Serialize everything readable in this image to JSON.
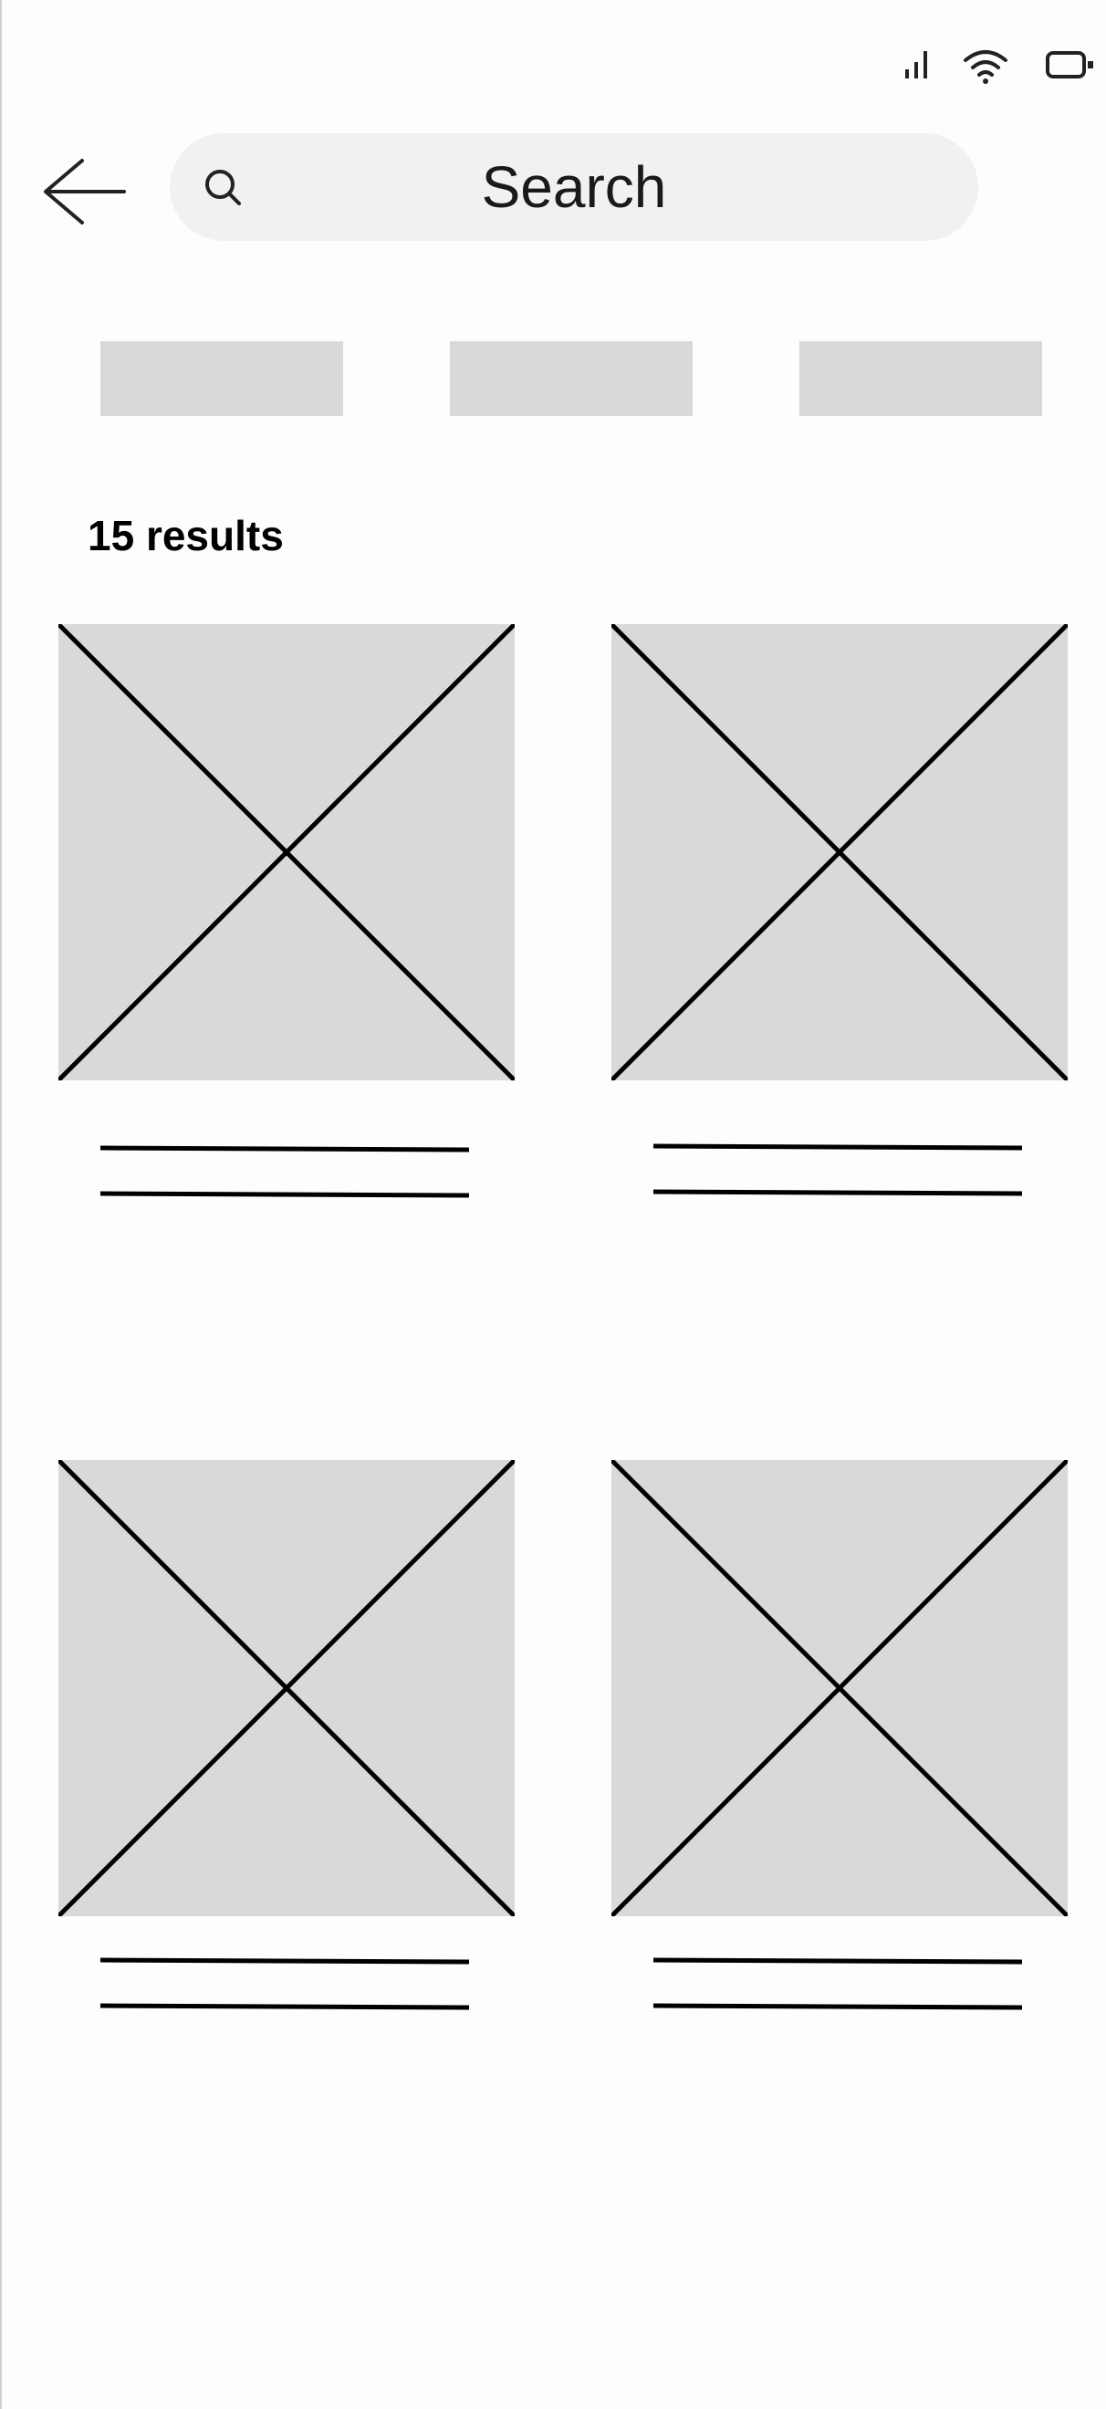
{
  "status_bar": {
    "icons": [
      "signal-icon",
      "wifi-icon",
      "battery-icon"
    ]
  },
  "header": {
    "back_icon": "arrow-left-icon",
    "search": {
      "text": "Search",
      "icon": "search-icon"
    }
  },
  "filter_chips": [
    {
      "label": ""
    },
    {
      "label": ""
    },
    {
      "label": ""
    }
  ],
  "results": {
    "count_label": "15 results",
    "items": [
      {
        "title": ""
      },
      {
        "title": ""
      },
      {
        "title": ""
      },
      {
        "title": ""
      }
    ]
  },
  "colors": {
    "placeholder": "#d9d9d9",
    "search_bg": "#f1f1f1",
    "text": "#000000"
  }
}
